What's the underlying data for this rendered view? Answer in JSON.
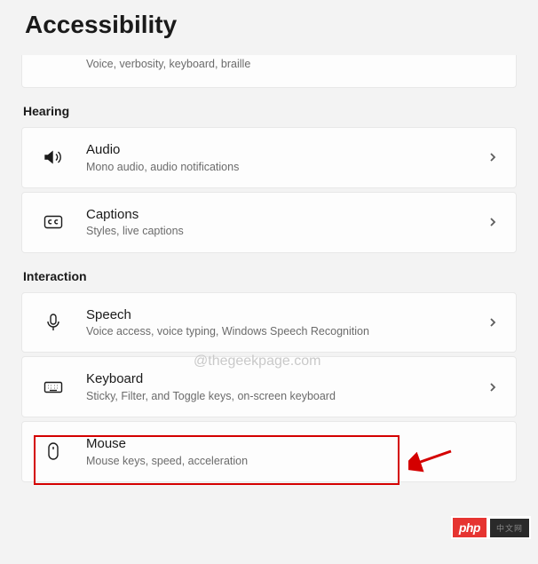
{
  "title": "Accessibility",
  "watermark": "@thegeekpage.com",
  "partial_item": {
    "subtitle": "Voice, verbosity, keyboard, braille"
  },
  "sections": {
    "hearing": {
      "header": "Hearing",
      "items": [
        {
          "title": "Audio",
          "subtitle": "Mono audio, audio notifications"
        },
        {
          "title": "Captions",
          "subtitle": "Styles, live captions"
        }
      ]
    },
    "interaction": {
      "header": "Interaction",
      "items": [
        {
          "title": "Speech",
          "subtitle": "Voice access, voice typing, Windows Speech Recognition"
        },
        {
          "title": "Keyboard",
          "subtitle": "Sticky, Filter, and Toggle keys, on-screen keyboard"
        },
        {
          "title": "Mouse",
          "subtitle": "Mouse keys, speed, acceleration"
        }
      ]
    }
  },
  "badge": {
    "php": "php",
    "extra": "中文网"
  }
}
